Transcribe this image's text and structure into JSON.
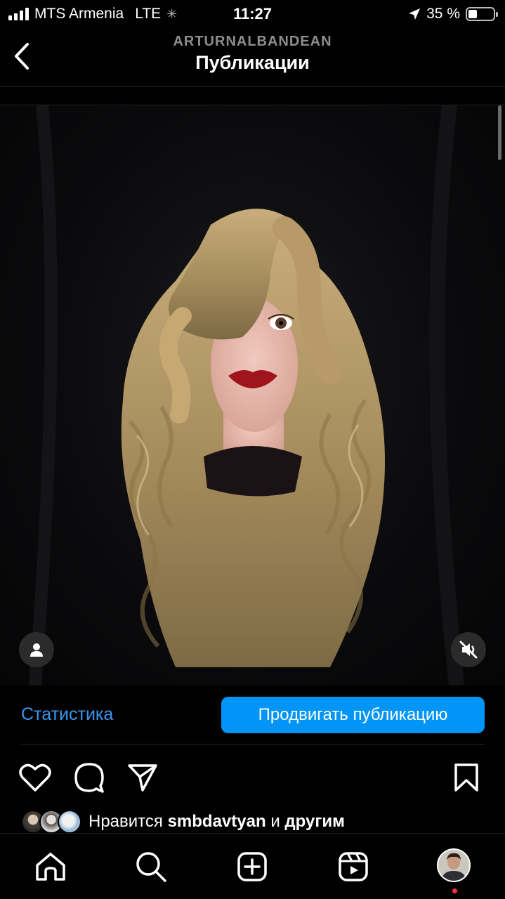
{
  "status_bar": {
    "carrier": "MTS Armenia",
    "network": "LTE",
    "time": "11:27",
    "battery": "35 %",
    "battery_level": 0.35
  },
  "header": {
    "username": "ARTURNALBANDEAN",
    "title": "Публикации"
  },
  "post": {
    "stats_label": "Статистика",
    "promote_label": "Продвигать публикацию",
    "likes": {
      "prefix": "Нравится",
      "user": "smbdavtyan",
      "conjunction": "и",
      "others": "другим"
    }
  },
  "icons": {
    "back": "chevron-left-icon",
    "tag_user": "person-icon",
    "mute": "speaker-muted-icon",
    "like": "heart-icon",
    "comment": "comment-bubble-icon",
    "share": "paper-plane-icon",
    "save": "bookmark-icon",
    "home": "home-icon",
    "search": "search-icon",
    "create": "plus-square-icon",
    "reels": "reels-icon"
  },
  "colors": {
    "accent": "#0095f6",
    "link": "#3797f0",
    "notification": "#ff3040",
    "background": "#000000"
  }
}
